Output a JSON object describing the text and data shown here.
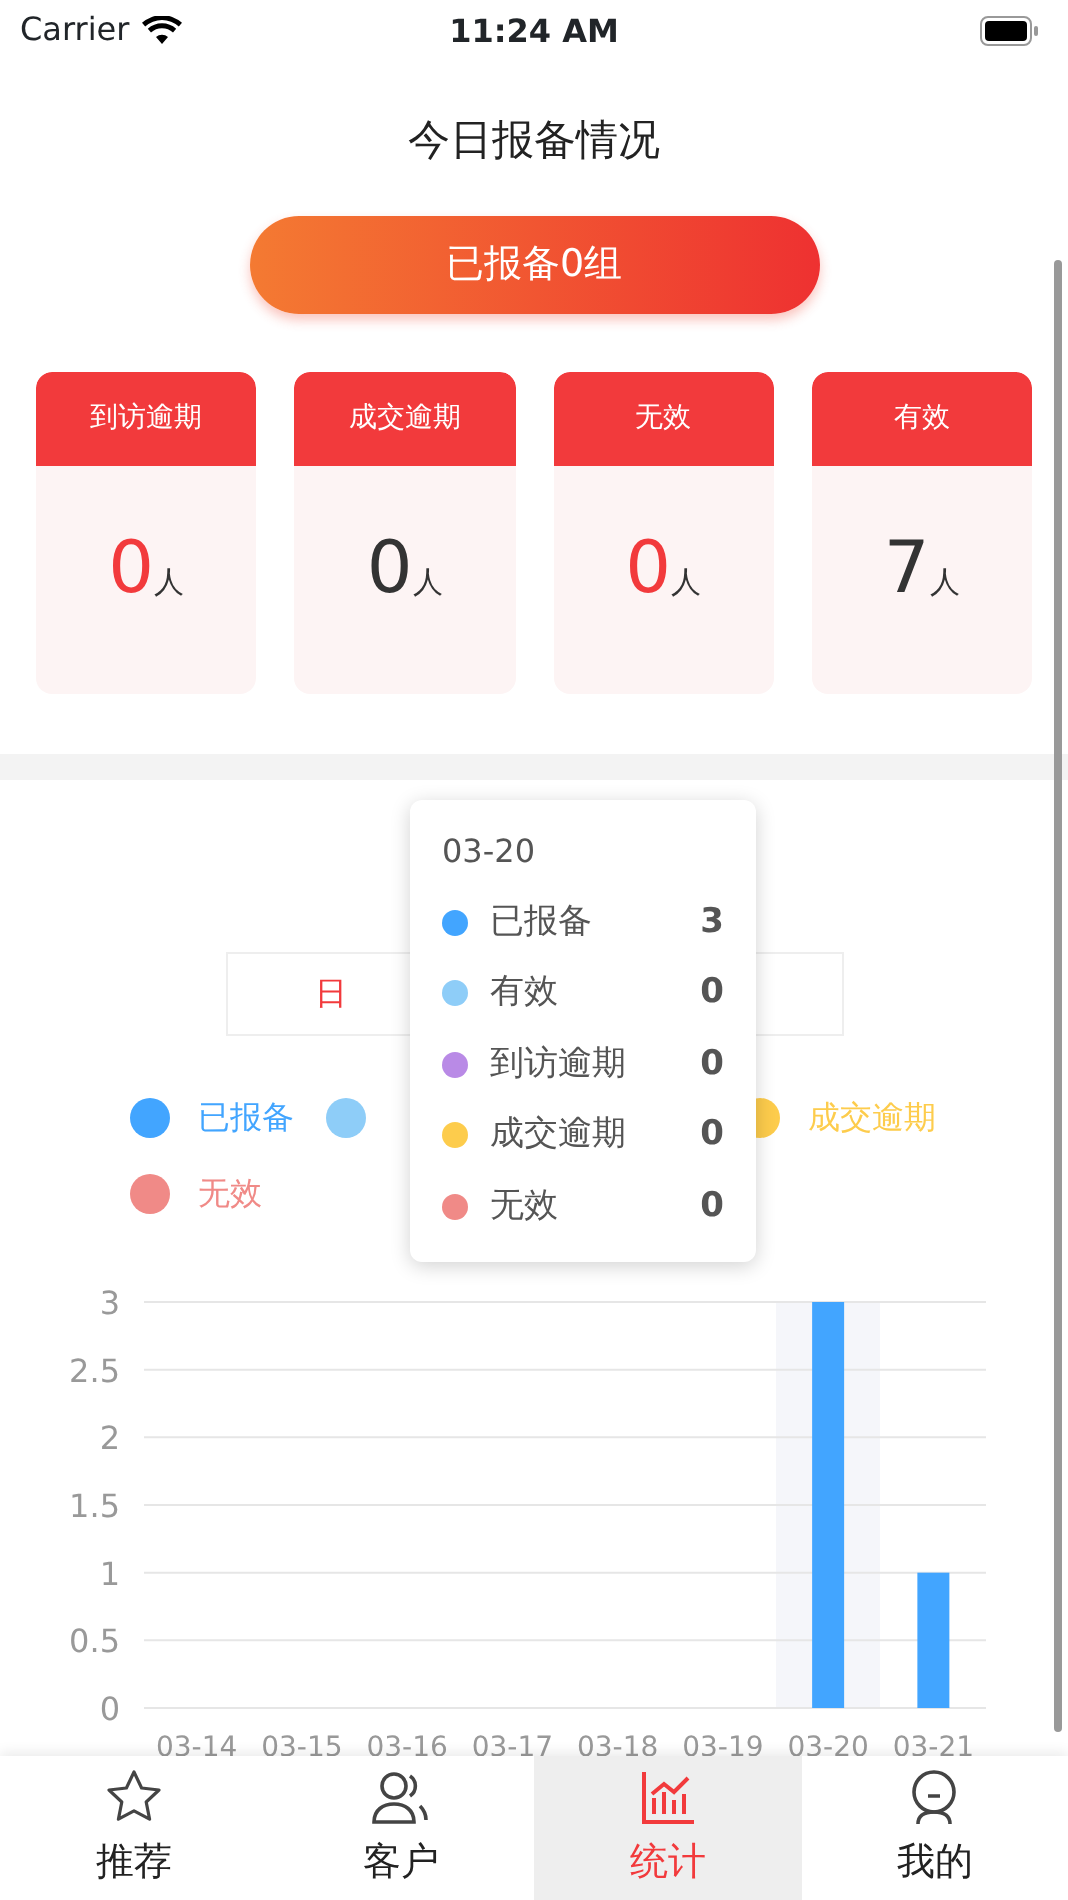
{
  "status_bar": {
    "carrier": "Carrier",
    "time": "11:24 AM"
  },
  "title": "今日报备情况",
  "summary_button": "已报备0组",
  "cards": [
    {
      "label": "到访逾期",
      "value": "0",
      "unit": "人",
      "color": "#f23a3c"
    },
    {
      "label": "成交逾期",
      "value": "0",
      "unit": "人",
      "color": "#333333"
    },
    {
      "label": "无效",
      "value": "0",
      "unit": "人",
      "color": "#f23a3c"
    },
    {
      "label": "有效",
      "value": "7",
      "unit": "人",
      "color": "#333333"
    }
  ],
  "period_tabs": [
    {
      "label": "日",
      "selected": true
    }
  ],
  "chart_data": {
    "type": "bar",
    "stacked": true,
    "categories": [
      "03-14",
      "03-15",
      "03-16",
      "03-17",
      "03-18",
      "03-19",
      "03-20",
      "03-21"
    ],
    "series": [
      {
        "color": "#42a5ff",
        "values": [
          0,
          0,
          0,
          0,
          0,
          0,
          3,
          1
        ]
      },
      {
        "color": "#8ecdf8",
        "values": [
          0,
          0,
          0,
          0,
          0,
          0,
          0,
          0
        ]
      },
      {
        "color": "#b98ae6",
        "values": [
          0,
          0,
          0,
          0,
          0,
          0,
          0,
          0
        ]
      },
      {
        "color": "#fdcc4c",
        "values": [
          0,
          0,
          0,
          0,
          0,
          0,
          0,
          0
        ]
      },
      {
        "color": "#f08a87",
        "values": [
          0,
          0,
          0,
          0,
          0,
          0,
          0,
          0
        ]
      }
    ],
    "ylim": [
      0,
      3
    ],
    "yticks": [
      {
        "value": 0,
        "label": "0"
      },
      {
        "value": 0.5,
        "label": "0.5"
      },
      {
        "value": 1,
        "label": "1"
      },
      {
        "value": 1.5,
        "label": "1.5"
      },
      {
        "value": 2,
        "label": "2"
      },
      {
        "value": 2.5,
        "label": "2.5"
      },
      {
        "value": 3,
        "label": "3"
      }
    ],
    "grid": true
  },
  "legend": [
    [
      {
        "label": "已报备",
        "color": "#42a5ff"
      },
      {
        "color": "#8ecdf8"
      },
      {
        "label": "成交逾期",
        "color": "#fdcc4c"
      }
    ],
    [
      {
        "label": "无效",
        "color": "#f08a87"
      }
    ]
  ],
  "tooltip": {
    "title": "03-20",
    "rows": [
      {
        "label": "已报备",
        "value": "3",
        "color": "#42a5ff"
      },
      {
        "label": "有效",
        "value": "0",
        "color": "#8ecdf8"
      },
      {
        "label": "到访逾期",
        "value": "0",
        "color": "#b98ae6"
      },
      {
        "label": "成交逾期",
        "value": "0",
        "color": "#fdcc4c"
      },
      {
        "label": "无效",
        "value": "0",
        "color": "#f08a87"
      }
    ]
  },
  "tab_bar": [
    {
      "kind": "star",
      "label": "推荐",
      "selected": false
    },
    {
      "kind": "people",
      "label": "客户",
      "selected": false
    },
    {
      "kind": "chart",
      "label": "统计",
      "selected": true
    },
    {
      "kind": "person",
      "label": "我的",
      "selected": false
    }
  ]
}
